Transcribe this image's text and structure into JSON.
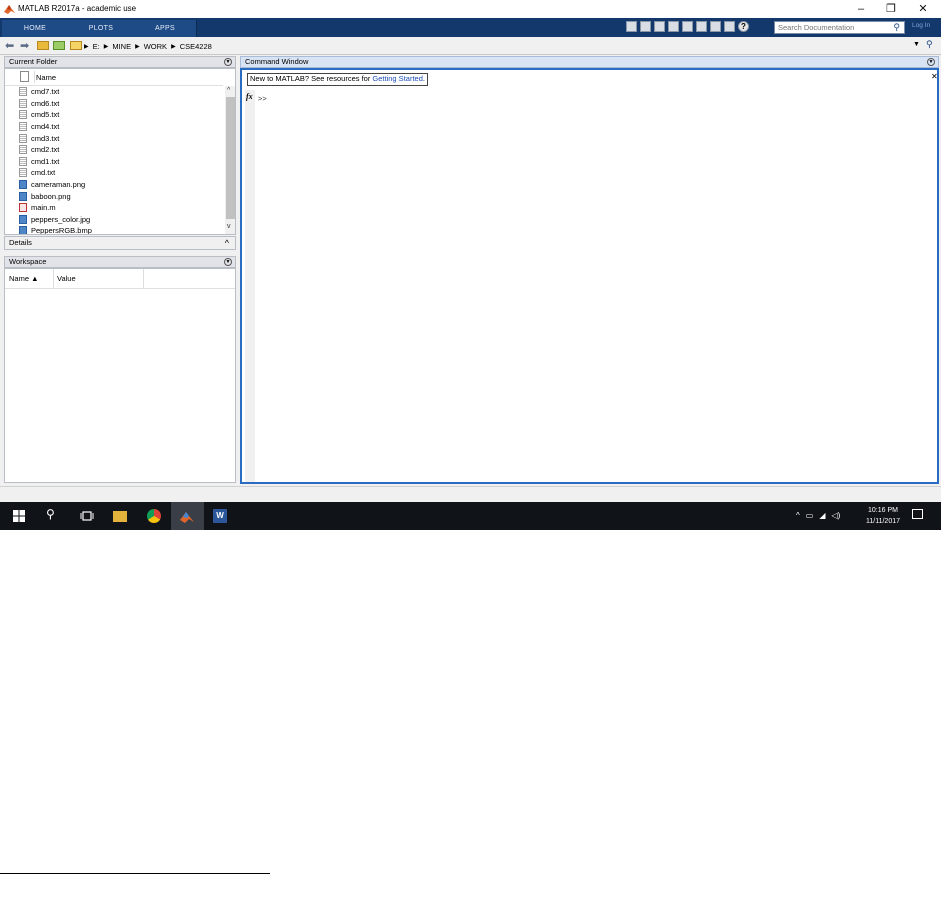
{
  "window": {
    "title": "MATLAB R2017a - academic use",
    "controls": [
      "–",
      "❐",
      "✕"
    ]
  },
  "ribbon": {
    "tabs": [
      "HOME",
      "PLOTS",
      "APPS"
    ],
    "search_placeholder": "Search Documentation",
    "login": "Log In",
    "help_glyph": "?"
  },
  "address": {
    "crumbs": [
      "E:",
      "MINE",
      "WORK",
      "CSE4228"
    ]
  },
  "current_folder": {
    "title": "Current Folder",
    "column": "Name",
    "files": [
      {
        "name": "cmd7.txt",
        "icon": "txt"
      },
      {
        "name": "cmd6.txt",
        "icon": "txt"
      },
      {
        "name": "cmd5.txt",
        "icon": "txt"
      },
      {
        "name": "cmd4.txt",
        "icon": "txt"
      },
      {
        "name": "cmd3.txt",
        "icon": "txt"
      },
      {
        "name": "cmd2.txt",
        "icon": "txt"
      },
      {
        "name": "cmd1.txt",
        "icon": "txt"
      },
      {
        "name": "cmd.txt",
        "icon": "txt"
      },
      {
        "name": "cameraman.png",
        "icon": "img"
      },
      {
        "name": "baboon.png",
        "icon": "img"
      },
      {
        "name": "main.m",
        "icon": "m"
      },
      {
        "name": "peppers_color.jpg",
        "icon": "img"
      },
      {
        "name": "PeppersRGB.bmp",
        "icon": "img"
      }
    ]
  },
  "details": {
    "title": "Details"
  },
  "workspace": {
    "title": "Workspace",
    "columns": [
      "Name ▲",
      "Value"
    ]
  },
  "command_window": {
    "title": "Command Window",
    "banner_text": "New to MATLAB? See resources for ",
    "banner_link": "Getting Started",
    "banner_end": ".",
    "fx": "fx",
    "prompt": ">>"
  },
  "taskbar": {
    "time": "10:16 PM",
    "date": "11/11/2017",
    "word_letter": "W"
  }
}
